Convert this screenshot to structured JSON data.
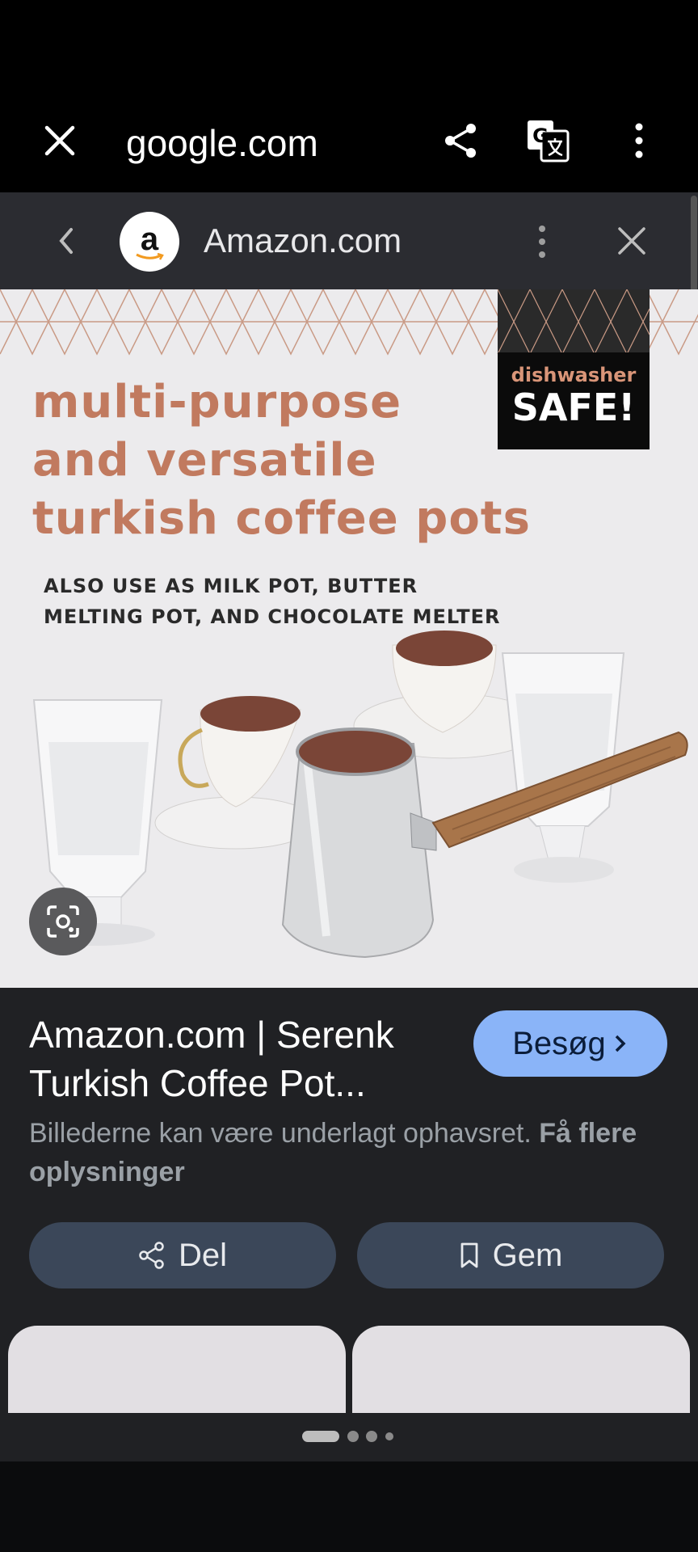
{
  "browser": {
    "url": "google.com",
    "icons": [
      "close-icon",
      "share-icon",
      "translate-icon",
      "more-vert-icon"
    ]
  },
  "panel": {
    "site_logo_letter": "a",
    "site_name": "Amazon.com",
    "icons": [
      "chevron-left-icon",
      "more-vert-icon",
      "close-icon"
    ]
  },
  "image": {
    "headline": [
      "multi-purpose",
      "and versatile",
      "turkish coffee pots"
    ],
    "subline": [
      "ALSO USE AS MILK POT, BUTTER",
      "MELTING POT, AND CHOCOLATE MELTER"
    ],
    "badge_top": "dishwasher",
    "badge_bottom": "SAFE!",
    "colors": {
      "accent": "#c17a5f",
      "badge_bg": "#0b0b0b"
    }
  },
  "result": {
    "title": "Amazon.com | Serenk Turkish Coffee Pot...",
    "visit_label": "Besøg",
    "notice_text": "Billederne kan være underlagt ophavsret. ",
    "notice_link": "Få flere oplysninger",
    "share_label": "Del",
    "save_label": "Gem"
  },
  "pagination": {
    "pages": 4,
    "current": 1
  },
  "colors": {
    "visit_button": "#8ab4f8",
    "pill": "#3b4759",
    "panel_bg": "#202124"
  }
}
